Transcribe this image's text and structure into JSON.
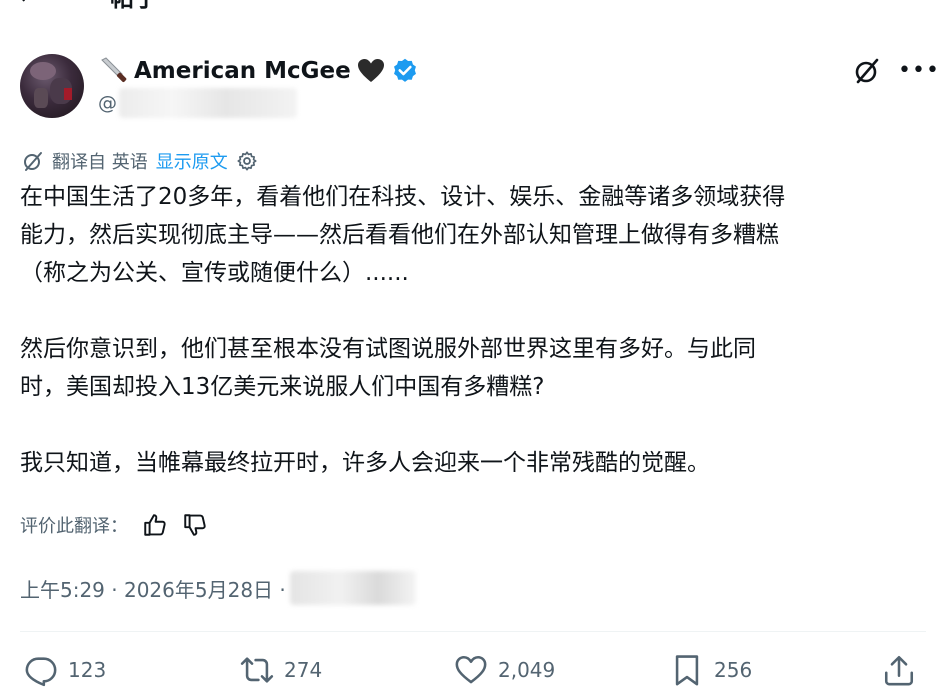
{
  "header": {
    "title": "帖子"
  },
  "author": {
    "display_name": "American McGee",
    "handle_prefix": "@"
  },
  "translation": {
    "label": "翻译自 英语",
    "show_original": "显示原文"
  },
  "tweet": {
    "lines": [
      "在中国生活了20多年，看着他们在科技、设计、娱乐、金融等诸多领域获得",
      "能力，然后实现彻底主导——然后看看他们在外部认知管理上做得有多糟糕",
      "（称之为公关、宣传或随便什么）......",
      "",
      "然后你意识到，他们甚至根本没有试图说服外部世界这里有多好。与此同",
      "时，美国却投入13亿美元来说服人们中国有多糟糕?",
      "",
      "我只知道，当帷幕最终拉开时，许多人会迎来一个非常残酷的觉醒。"
    ]
  },
  "rate_translation": {
    "label": "评价此翻译："
  },
  "timestamp": {
    "text": "上午5:29 · 2026年5月28日 ·"
  },
  "stats": {
    "replies": "123",
    "reposts": "274",
    "likes": "2,049",
    "bookmarks": "256"
  },
  "icons": {
    "verified": "verified-badge-icon",
    "heart": "black-heart-icon",
    "knife": "knife-icon",
    "grok": "grok-icon",
    "more": "more-icon",
    "gear": "gear-icon",
    "thumbs_up": "thumbs-up-icon",
    "thumbs_down": "thumbs-down-icon",
    "reply": "reply-icon",
    "repost": "repost-icon",
    "like": "like-icon",
    "bookmark": "bookmark-icon",
    "share": "share-icon"
  },
  "colors": {
    "accent": "#1d9bf0",
    "text": "#0f1419",
    "muted": "#536471"
  }
}
